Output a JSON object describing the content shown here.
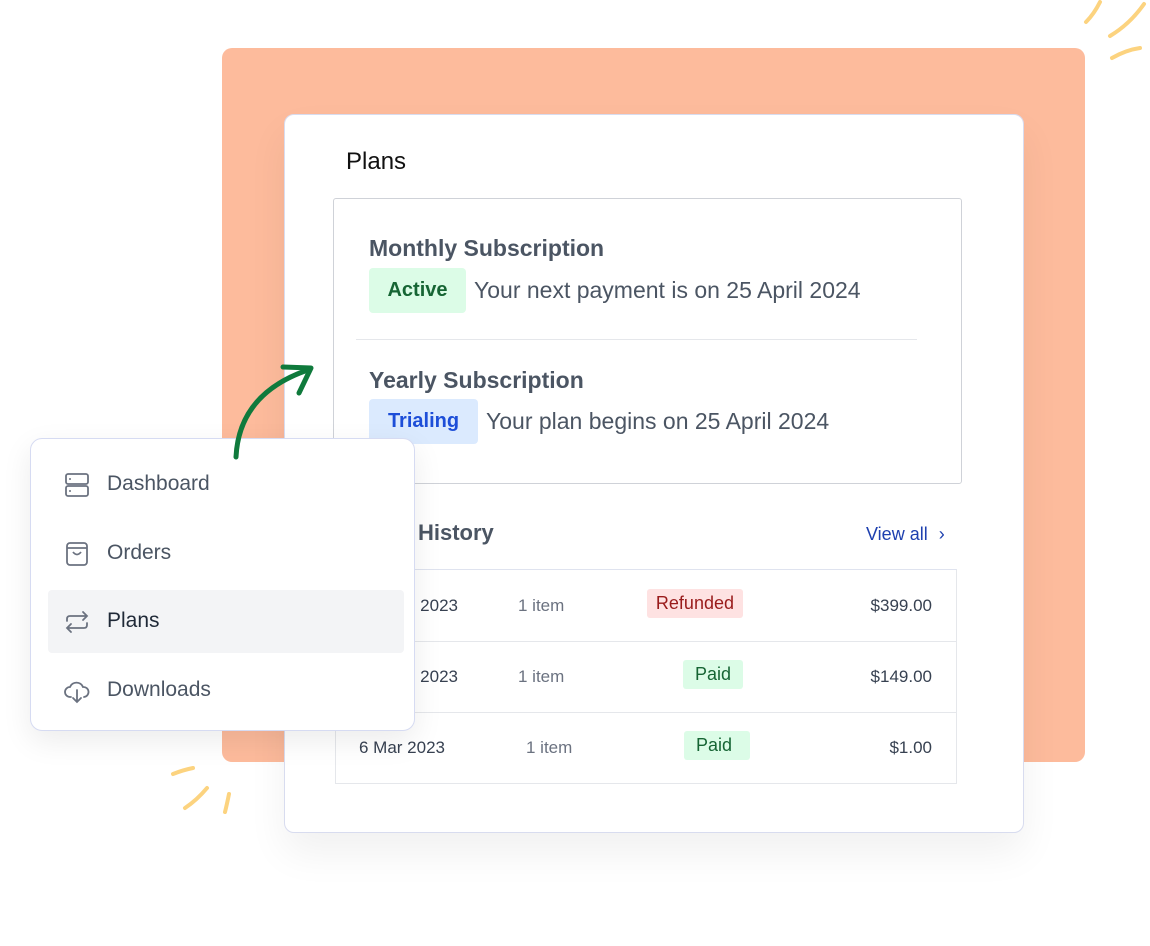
{
  "card": {
    "title": "Plans"
  },
  "subscriptions": [
    {
      "name": "Monthly Subscription",
      "status": "Active",
      "text": "Your next payment is on 25 April 2024"
    },
    {
      "name": "Yearly Subscription",
      "status": "Trialing",
      "text": "Your plan begins on 25 April 2024"
    }
  ],
  "history": {
    "title": "History",
    "view_all": "View all",
    "rows": [
      {
        "date": "2023",
        "items": "1 item",
        "status": "Refunded",
        "amount": "$399.00"
      },
      {
        "date": "2023",
        "items": "1 item",
        "status": "Paid",
        "amount": "$149.00"
      },
      {
        "date": "6 Mar 2023",
        "items": "1 item",
        "status": "Paid",
        "amount": "$1.00"
      }
    ]
  },
  "menu": {
    "items": [
      {
        "label": "Dashboard",
        "icon": "server-icon"
      },
      {
        "label": "Orders",
        "icon": "shopping-bag-icon"
      },
      {
        "label": "Plans",
        "icon": "arrows-repeat-icon",
        "active": true
      },
      {
        "label": "Downloads",
        "icon": "cloud-download-icon"
      }
    ]
  },
  "colors": {
    "backdrop": "#fdbb9c",
    "arrow": "#0f7a3c",
    "accent": "#1e40af",
    "paid_bg": "#dcfce7",
    "refunded_bg": "#fee2e2",
    "trialing_bg": "#dbeafe"
  }
}
